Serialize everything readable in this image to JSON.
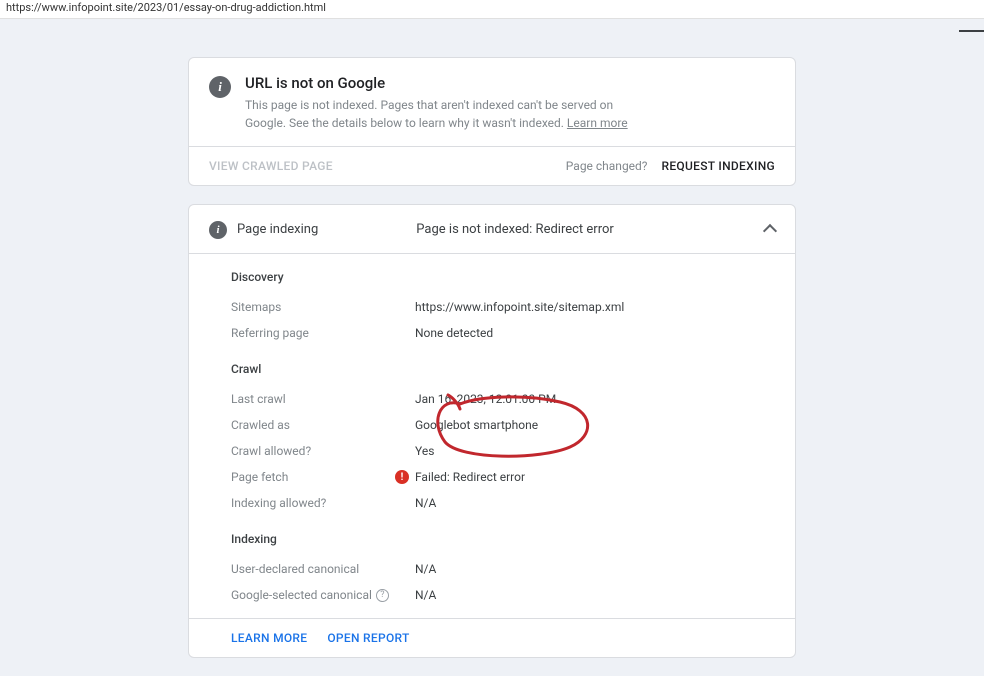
{
  "url_bar": "https://www.infopoint.site/2023/01/essay-on-drug-addiction.html",
  "status_card": {
    "title": "URL is not on Google",
    "desc_a": "This page is not indexed. Pages that aren't indexed can't be served on Google. See the details below to learn why it wasn't indexed. ",
    "learn_more": "Learn more",
    "view_crawled": "VIEW CRAWLED PAGE",
    "page_changed": "Page changed?",
    "request_indexing": "REQUEST INDEXING"
  },
  "panel": {
    "title": "Page indexing",
    "status": "Page is not indexed: Redirect error"
  },
  "discovery": {
    "heading": "Discovery",
    "sitemaps_label": "Sitemaps",
    "sitemaps_value": "https://www.infopoint.site/sitemap.xml",
    "referring_label": "Referring page",
    "referring_value": "None detected"
  },
  "crawl": {
    "heading": "Crawl",
    "last_label": "Last crawl",
    "last_value": "Jan 16, 2023, 12:01:00 PM",
    "as_label": "Crawled as",
    "as_value": "Googlebot smartphone",
    "allowed_label": "Crawl allowed?",
    "allowed_value": "Yes",
    "fetch_label": "Page fetch",
    "fetch_value": "Failed: Redirect error",
    "index_allowed_label": "Indexing allowed?",
    "index_allowed_value": "N/A"
  },
  "indexing": {
    "heading": "Indexing",
    "user_canonical_label": "User-declared canonical",
    "user_canonical_value": "N/A",
    "google_canonical_label": "Google-selected canonical",
    "google_canonical_value": "N/A"
  },
  "footer": {
    "learn_more": "LEARN MORE",
    "open_report": "OPEN REPORT"
  }
}
